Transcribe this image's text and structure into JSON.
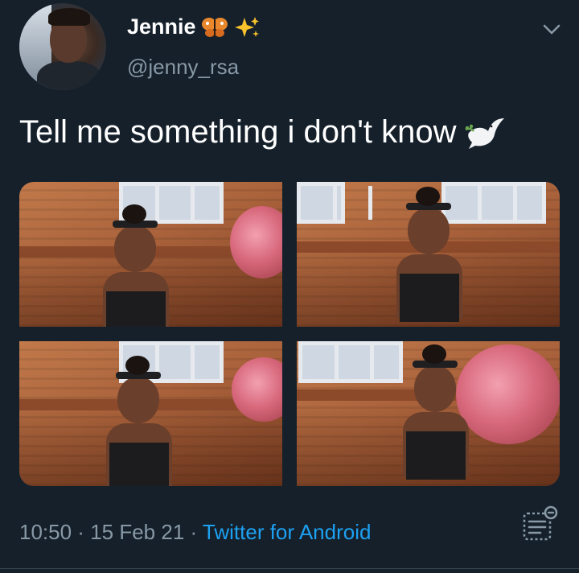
{
  "author": {
    "name": "Jennie",
    "handle": "@jenny_rsa",
    "name_emojis": [
      "butterfly-emoji",
      "sparkles-emoji"
    ]
  },
  "tweet": {
    "text": "Tell me something i don't know",
    "trailing_emoji": "dove-emoji"
  },
  "media": {
    "count": 4,
    "photos": [
      {
        "label": "photo-1"
      },
      {
        "label": "photo-2"
      },
      {
        "label": "photo-3"
      },
      {
        "label": "photo-4"
      }
    ]
  },
  "meta": {
    "time": "10:50",
    "separator": " · ",
    "date": "15 Feb 21",
    "source": "Twitter for Android"
  },
  "icons": {
    "menu": "chevron-down-icon",
    "analytics": "analytics-icon"
  },
  "colors": {
    "background": "#15202b",
    "primary_text": "#ffffff",
    "secondary_text": "#8899a6",
    "link": "#1da1f2"
  }
}
